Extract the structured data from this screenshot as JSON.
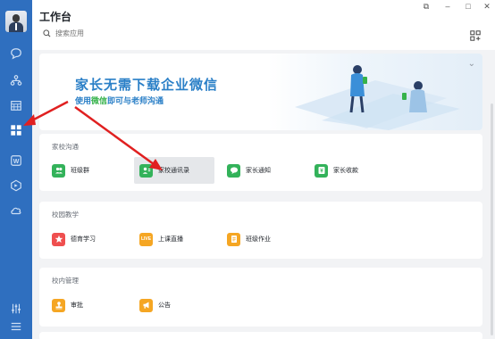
{
  "header": {
    "title": "工作台",
    "search_placeholder": "搜索应用"
  },
  "window_controls": [
    "⧉",
    "–",
    "□",
    "✕"
  ],
  "banner": {
    "headline": "家长无需下载企业微信",
    "sub_prefix": "使用",
    "sub_highlight": "微信",
    "sub_suffix": "即可与老师沟通",
    "colors": {
      "headline": "#2a7fc7",
      "highlight": "#36b24a"
    }
  },
  "sections": [
    {
      "title": "家校沟通",
      "items": [
        {
          "label": "班级群",
          "icon": "class-group-icon",
          "color": "#33b25a"
        },
        {
          "label": "家校通讯录",
          "icon": "contacts-icon",
          "color": "#33b25a",
          "active": true
        },
        {
          "label": "家长通知",
          "icon": "notice-icon",
          "color": "#33b25a"
        },
        {
          "label": "家长收款",
          "icon": "payment-icon",
          "color": "#33b25a"
        }
      ]
    },
    {
      "title": "校园教学",
      "items": [
        {
          "label": "德育学习",
          "icon": "star-icon",
          "color": "#ef4f4f"
        },
        {
          "label": "上课直播",
          "icon": "live-icon",
          "color": "#f5a623",
          "badge": "LIVE"
        },
        {
          "label": "班级作业",
          "icon": "homework-icon",
          "color": "#f5a623"
        }
      ]
    },
    {
      "title": "校内管理",
      "items": [
        {
          "label": "审批",
          "icon": "approval-icon",
          "color": "#f5a623"
        },
        {
          "label": "公告",
          "icon": "announcement-icon",
          "color": "#f5a623"
        }
      ]
    }
  ],
  "sidebar": {
    "icons": [
      "message-icon",
      "org-icon",
      "calendar-icon",
      "workbench-icon",
      "doc-icon",
      "cube-icon",
      "cloud-icon",
      "settings-sliders-icon",
      "menu-icon"
    ],
    "color": "#2f6fbf"
  },
  "annotation_color": "#e02020"
}
